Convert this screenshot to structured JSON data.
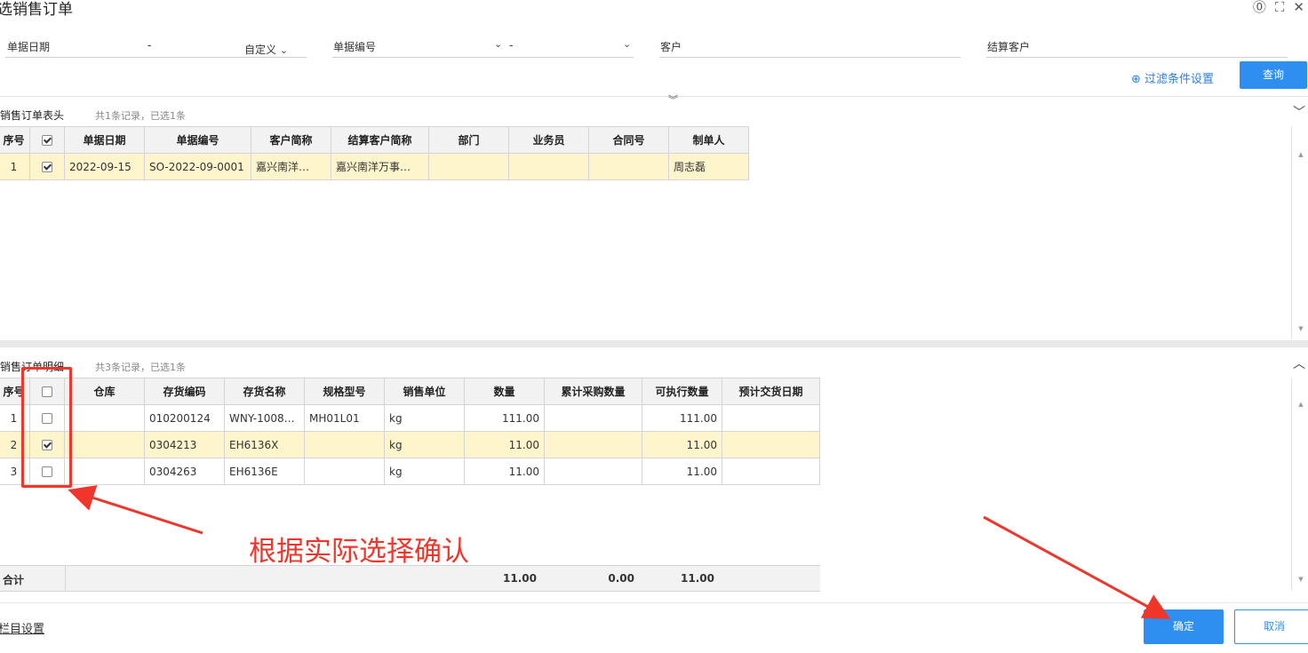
{
  "dialog": {
    "title": "选销售订单"
  },
  "filters": {
    "date_label": "单据日期",
    "date_sep": "-",
    "date_mode": "自定义",
    "number_label": "单据编号",
    "number_sep": "-",
    "customer_label": "客户",
    "settle_customer_label": "结算客户",
    "filter_settings": "过滤条件设置",
    "query_button": "查询"
  },
  "header_section": {
    "title": "销售订单表头",
    "count": "共1条记录，已选1条",
    "columns": [
      "序号",
      "",
      "单据日期",
      "单据编号",
      "客户简称",
      "结算客户简称",
      "部门",
      "业务员",
      "合同号",
      "制单人"
    ],
    "rows": [
      {
        "seq": "1",
        "checked": true,
        "date": "2022-09-15",
        "number": "SO-2022-09-0001",
        "customer": "嘉兴南洋…",
        "settle_customer": "嘉兴南洋万事…",
        "dept": "",
        "salesman": "",
        "contract": "",
        "creator": "周志磊"
      }
    ]
  },
  "detail_section": {
    "title": "销售订单明细",
    "count": "共3条记录，已选1条",
    "columns": [
      "序号",
      "",
      "仓库",
      "存货编码",
      "存货名称",
      "规格型号",
      "销售单位",
      "数量",
      "累计采购数量",
      "可执行数量",
      "预计交货日期"
    ],
    "rows": [
      {
        "seq": "1",
        "checked": false,
        "warehouse": "",
        "code": "010200124",
        "name": "WNY-1008…",
        "spec": "MH01L01",
        "unit": "kg",
        "qty": "111.00",
        "purchased": "",
        "executable": "111.00",
        "delivery": ""
      },
      {
        "seq": "2",
        "checked": true,
        "warehouse": "",
        "code": "0304213",
        "name": "EH6136X",
        "spec": "",
        "unit": "kg",
        "qty": "11.00",
        "purchased": "",
        "executable": "11.00",
        "delivery": ""
      },
      {
        "seq": "3",
        "checked": false,
        "warehouse": "",
        "code": "0304263",
        "name": "EH6136E",
        "spec": "",
        "unit": "kg",
        "qty": "11.00",
        "purchased": "",
        "executable": "11.00",
        "delivery": ""
      }
    ],
    "totals": {
      "label": "合计",
      "qty": "11.00",
      "purchased": "0.00",
      "executable": "11.00"
    }
  },
  "footer": {
    "column_settings": "栏目设置",
    "confirm": "确定",
    "cancel": "取消"
  },
  "annotation": {
    "text": "根据实际选择确认",
    "color": "#f0352a"
  },
  "colors": {
    "accent": "#2f8ff0",
    "selected_row": "#fff5cc"
  }
}
